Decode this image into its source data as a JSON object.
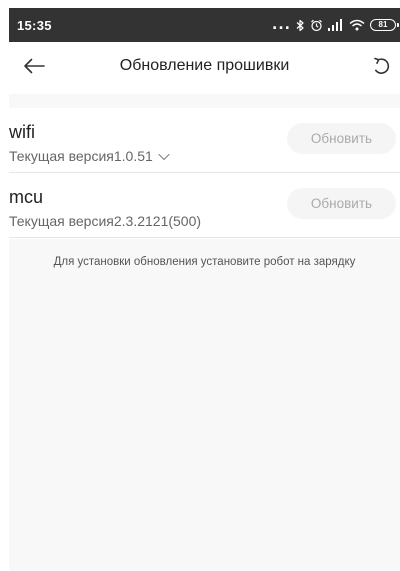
{
  "status_bar": {
    "time": "15:35",
    "dots": "...",
    "battery": "81"
  },
  "header": {
    "title": "Обновление прошивки"
  },
  "modules": [
    {
      "name": "wifi",
      "version": "Текущая версия1.0.51",
      "has_dropdown": true,
      "button_label": "Обновить"
    },
    {
      "name": "mcu",
      "version": "Текущая версия2.3.2121(500)",
      "has_dropdown": false,
      "button_label": "Обновить"
    }
  ],
  "hint": "Для установки обновления установите робот на зарядку",
  "colors": {
    "status_bar_bg": "#333333",
    "page_bg": "#f8f8f8",
    "button_bg": "#f5f5f5",
    "button_text": "#aaaaaa"
  }
}
